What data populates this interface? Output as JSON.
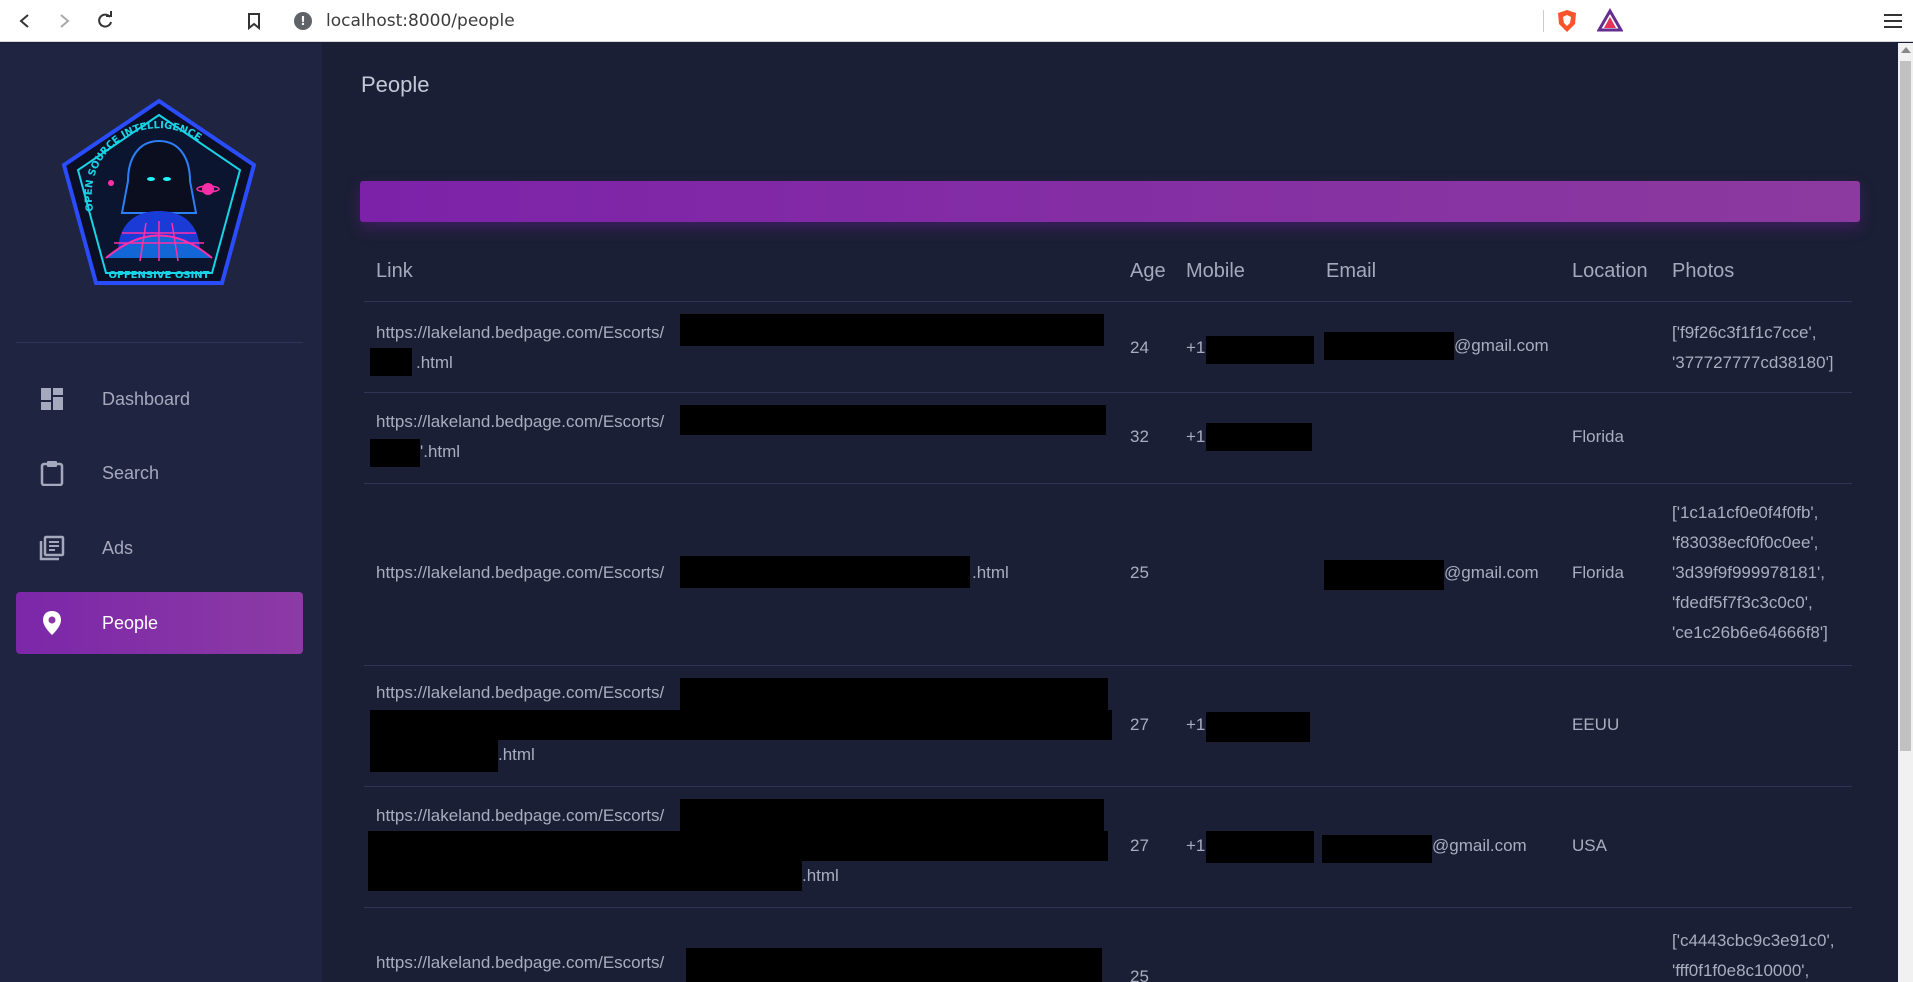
{
  "browser": {
    "url": "localhost:8000/people"
  },
  "logo": {
    "text_top": "OPEN SOURCE INTELLIGENCE",
    "text_bottom": "OFFENSIVE OSINT"
  },
  "sidebar": {
    "items": [
      {
        "label": "Dashboard",
        "icon": "dashboard-icon"
      },
      {
        "label": "Search",
        "icon": "clipboard-icon"
      },
      {
        "label": "Ads",
        "icon": "library-books-icon"
      },
      {
        "label": "People",
        "icon": "location-pin-icon",
        "active": true
      }
    ]
  },
  "page": {
    "title": "People"
  },
  "table": {
    "headers": [
      "Link",
      "Age",
      "Mobile",
      "Email",
      "Location",
      "Photos"
    ],
    "rows": [
      {
        "link_prefix": "https://lakeland.bedpage.com/Escorts/",
        "link_suffix": ".html",
        "age": "24",
        "mobile": "+1",
        "email_suffix": "@gmail.com",
        "location": "",
        "photos": [
          "['f9f26c3f1f1c7cce',",
          "'377727777cd38180']"
        ]
      },
      {
        "link_prefix": "https://lakeland.bedpage.com/Escorts/",
        "link_suffix": "'.html",
        "age": "32",
        "mobile": "+1",
        "email_suffix": "",
        "location": "Florida",
        "photos": []
      },
      {
        "link_prefix": "https://lakeland.bedpage.com/Escorts/",
        "link_suffix": ".html",
        "age": "25",
        "mobile": "",
        "email_suffix": "@gmail.com",
        "location": "Florida",
        "photos": [
          "['1c1a1cf0e0f4f0fb',",
          "'f83038ecf0f0c0ee',",
          "'3d39f9f999978181',",
          "'fdedf5f7f3c3c0c0',",
          "'ce1c26b6e64666f8']"
        ]
      },
      {
        "link_prefix": "https://lakeland.bedpage.com/Escorts/",
        "link_suffix": ".html",
        "age": "27",
        "mobile": "+1",
        "email_suffix": "",
        "location": "EEUU",
        "photos": []
      },
      {
        "link_prefix": "https://lakeland.bedpage.com/Escorts/",
        "link_suffix": ".html",
        "age": "27",
        "mobile": "+1",
        "email_suffix": "@gmail.com",
        "location": "USA",
        "photos": []
      },
      {
        "link_prefix": "https://lakeland.bedpage.com/Escorts/",
        "link_suffix": "",
        "age": "25",
        "mobile": "",
        "email_suffix": "",
        "location": "",
        "photos": [
          "['c4443cbc9c3e91c0',",
          "'fff0f1f0e8c10000',"
        ]
      }
    ]
  },
  "colors": {
    "accent": "#7c22a9",
    "sidebar_bg": "#1f2540",
    "main_bg": "#1b1f35"
  }
}
